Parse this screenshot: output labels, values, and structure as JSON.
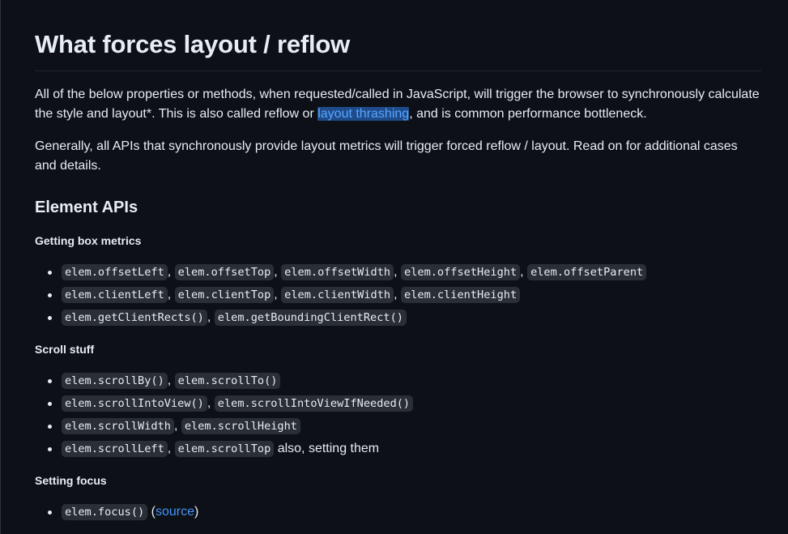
{
  "heading": "What forces layout / reflow",
  "intro": {
    "text_before": "All of the below properties or methods, when requested/called in JavaScript, will trigger the browser to synchronously calculate the style and layout*. This is also called reflow or ",
    "link": "layout thrashing",
    "text_after": ", and is common performance bottleneck."
  },
  "general": "Generally, all APIs that synchronously provide layout metrics will trigger forced reflow / layout. Read on for additional cases and details.",
  "element_apis": {
    "title": "Element APIs",
    "box_metrics": {
      "title": "Getting box metrics",
      "items": [
        [
          "elem.offsetLeft",
          "elem.offsetTop",
          "elem.offsetWidth",
          "elem.offsetHeight",
          "elem.offsetParent"
        ],
        [
          "elem.clientLeft",
          "elem.clientTop",
          "elem.clientWidth",
          "elem.clientHeight"
        ],
        [
          "elem.getClientRects()",
          "elem.getBoundingClientRect()"
        ]
      ]
    },
    "scroll": {
      "title": "Scroll stuff",
      "items": [
        [
          "elem.scrollBy()",
          "elem.scrollTo()"
        ],
        [
          "elem.scrollIntoView()",
          "elem.scrollIntoViewIfNeeded()"
        ],
        [
          "elem.scrollWidth",
          "elem.scrollHeight"
        ],
        [
          "elem.scrollLeft",
          "elem.scrollTop"
        ]
      ],
      "scroll_note": "also, setting them"
    },
    "focus": {
      "title": "Setting focus",
      "code": "elem.focus()",
      "paren_open": "(",
      "source_link": "source",
      "paren_close": ")"
    }
  },
  "separator": ",",
  "colors": {
    "background": "#0d1117",
    "text": "#e6edf3",
    "link": "#4493f8",
    "code_bg": "#2a2f36",
    "selection_bg": "#1f4b8a"
  }
}
